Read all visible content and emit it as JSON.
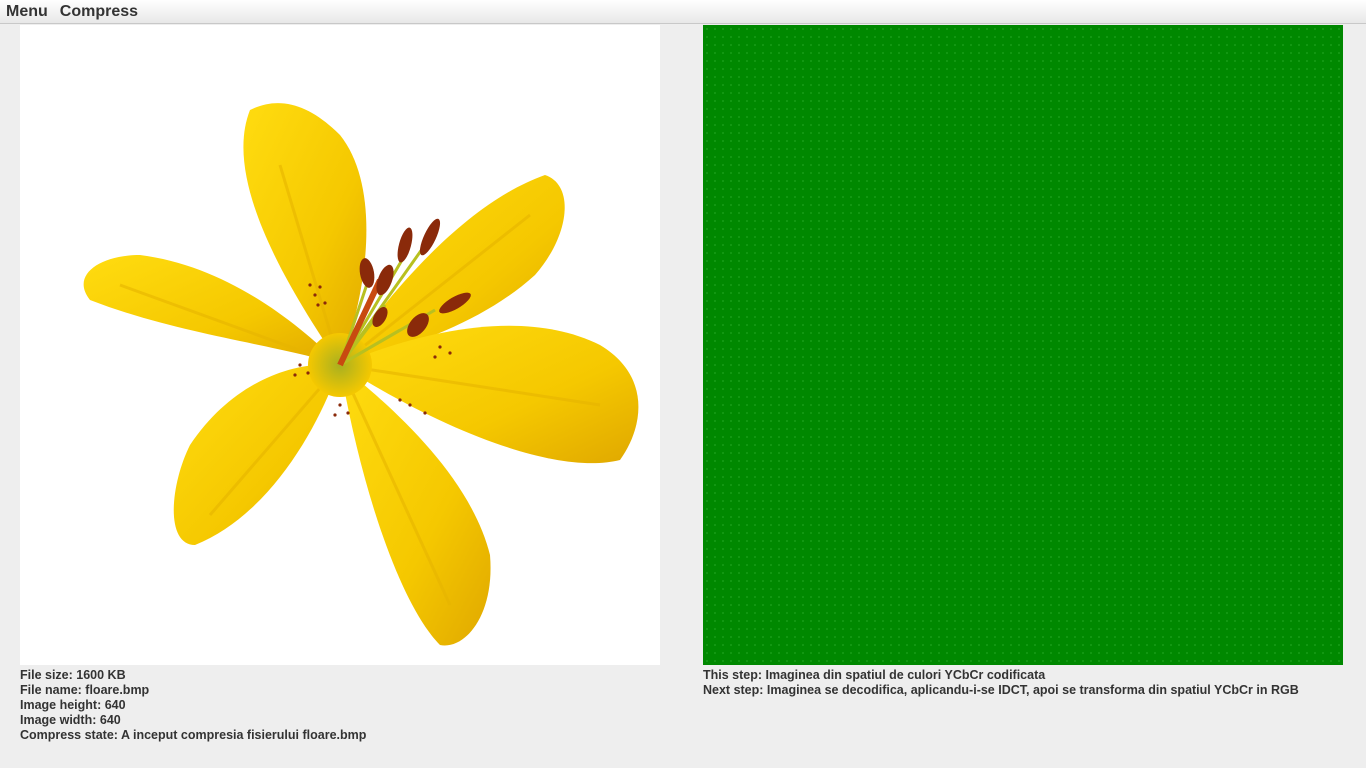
{
  "menubar": {
    "items": [
      {
        "label": "Menu"
      },
      {
        "label": "Compress"
      }
    ]
  },
  "original_image": {
    "subject": "yellow lily flower",
    "colors": {
      "petal": "#f5c800",
      "petal_shade": "#e0a800",
      "stamen": "#8a2a0a",
      "background": "#ffffff"
    }
  },
  "processed_image": {
    "colors": {
      "fill": "#008800",
      "dots": "#28aa28"
    }
  },
  "file_info": {
    "size": "File size: 1600 KB",
    "name": "File name: floare.bmp",
    "height": "Image height: 640",
    "width": "Image width: 640",
    "state": "Compress state: A inceput compresia fisierului floare.bmp"
  },
  "steps": {
    "this_step": "This step: Imaginea din spatiul de culori YCbCr codificata",
    "next_step": "Next step: Imaginea se decodifica, aplicandu-i-se IDCT, apoi se transforma din spatiul YCbCr in RGB"
  }
}
